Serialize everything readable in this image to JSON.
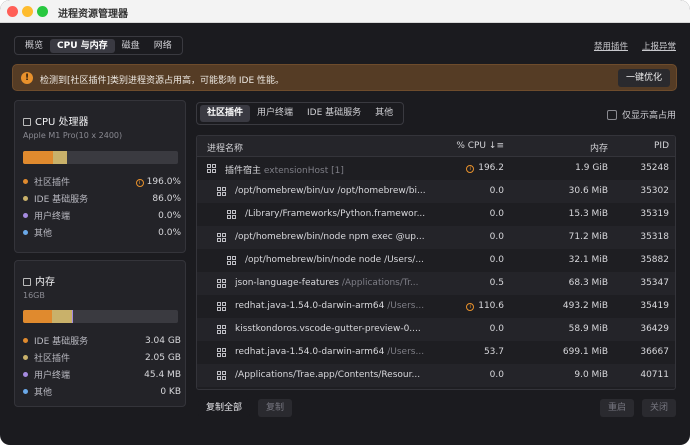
{
  "window": {
    "title": "进程资源管理器"
  },
  "main_tabs": [
    "概览",
    "CPU 与内存",
    "磁盘",
    "网络"
  ],
  "top_links": {
    "disable_plugins": "禁用插件",
    "report_issue": "上报异常"
  },
  "banner": {
    "message": "检测到[社区插件]类别进程资源占用高，可能影响 IDE 性能。",
    "fix_label": "一键优化",
    "icon": "warning-icon"
  },
  "cpu_panel": {
    "title": "CPU 处理器",
    "subtitle": "Apple M1 Pro(10 x 2400)",
    "bar": [
      {
        "label": "社区插件",
        "pct": 19.6,
        "color": "#e08a2e"
      },
      {
        "label": "IDE 基础服务",
        "pct": 8.6,
        "color": "#c9b16a"
      }
    ],
    "legend": [
      {
        "label": "社区插件",
        "value": "196.0%",
        "color": "#e08a2e",
        "warn": true
      },
      {
        "label": "IDE 基础服务",
        "value": "86.0%",
        "color": "#c9b16a",
        "warn": false
      },
      {
        "label": "用户终端",
        "value": "0.0%",
        "color": "#a58be0",
        "warn": false
      },
      {
        "label": "其他",
        "value": "0.0%",
        "color": "#6aa8e8",
        "warn": false
      }
    ]
  },
  "mem_panel": {
    "title": "内存",
    "subtitle": "16GB",
    "bar": [
      {
        "label": "IDE 基础服务",
        "pct": 19.0,
        "color": "#e08a2e"
      },
      {
        "label": "社区插件",
        "pct": 12.8,
        "color": "#c9b16a"
      },
      {
        "label": "用户终端",
        "pct": 0.3,
        "color": "#a58be0"
      }
    ],
    "legend": [
      {
        "label": "IDE 基础服务",
        "value": "3.04 GB",
        "color": "#e08a2e"
      },
      {
        "label": "社区插件",
        "value": "2.05 GB",
        "color": "#c9b16a"
      },
      {
        "label": "用户终端",
        "value": "45.4 MB",
        "color": "#a58be0"
      },
      {
        "label": "其他",
        "value": "0 KB",
        "color": "#6aa8e8"
      }
    ]
  },
  "sub_tabs": [
    "社区插件",
    "用户终端",
    "IDE 基础服务",
    "其他"
  ],
  "only_high_label": "仅显示高占用",
  "table": {
    "headers": {
      "name": "进程名称",
      "cpu": "% CPU",
      "mem": "内存",
      "pid": "PID"
    },
    "rows": [
      {
        "indent": 0,
        "name": "插件宿主",
        "suffix": "extensionHost [1]",
        "cpu": "196.2",
        "cpu_warn": true,
        "mem": "1.9 GiB",
        "pid": "35248"
      },
      {
        "indent": 1,
        "name": "/opt/homebrew/bin/uv /opt/homebrew/bi...",
        "suffix": "",
        "cpu": "0.0",
        "cpu_warn": false,
        "mem": "30.6 MiB",
        "pid": "35302"
      },
      {
        "indent": 2,
        "name": "/Library/Frameworks/Python.framewor...",
        "suffix": "",
        "cpu": "0.0",
        "cpu_warn": false,
        "mem": "15.3 MiB",
        "pid": "35319"
      },
      {
        "indent": 1,
        "name": "/opt/homebrew/bin/node npm exec @up...",
        "suffix": "",
        "cpu": "0.0",
        "cpu_warn": false,
        "mem": "71.2 MiB",
        "pid": "35318"
      },
      {
        "indent": 2,
        "name": "/opt/homebrew/bin/node node /Users/...",
        "suffix": "",
        "cpu": "0.0",
        "cpu_warn": false,
        "mem": "32.1 MiB",
        "pid": "35882"
      },
      {
        "indent": 1,
        "name": "json-language-features",
        "suffix": "/Applications/Tr...",
        "cpu": "0.5",
        "cpu_warn": false,
        "mem": "68.3 MiB",
        "pid": "35347"
      },
      {
        "indent": 1,
        "name": "redhat.java-1.54.0-darwin-arm64",
        "suffix": "/Users...",
        "cpu": "110.6",
        "cpu_warn": true,
        "mem": "493.2 MiB",
        "pid": "35419"
      },
      {
        "indent": 1,
        "name": "kisstkondoros.vscode-gutter-preview-0....",
        "suffix": "",
        "cpu": "0.0",
        "cpu_warn": false,
        "mem": "58.9 MiB",
        "pid": "36429"
      },
      {
        "indent": 1,
        "name": "redhat.java-1.54.0-darwin-arm64",
        "suffix": "/Users...",
        "cpu": "53.7",
        "cpu_warn": false,
        "mem": "699.1 MiB",
        "pid": "36667"
      },
      {
        "indent": 1,
        "name": "/Applications/Trae.app/Contents/Resour...",
        "suffix": "",
        "cpu": "0.0",
        "cpu_warn": false,
        "mem": "9.0 MiB",
        "pid": "40711"
      }
    ]
  },
  "footer": {
    "copy_all": "复制全部",
    "copy": "复制",
    "restart": "重启",
    "close": "关闭"
  }
}
